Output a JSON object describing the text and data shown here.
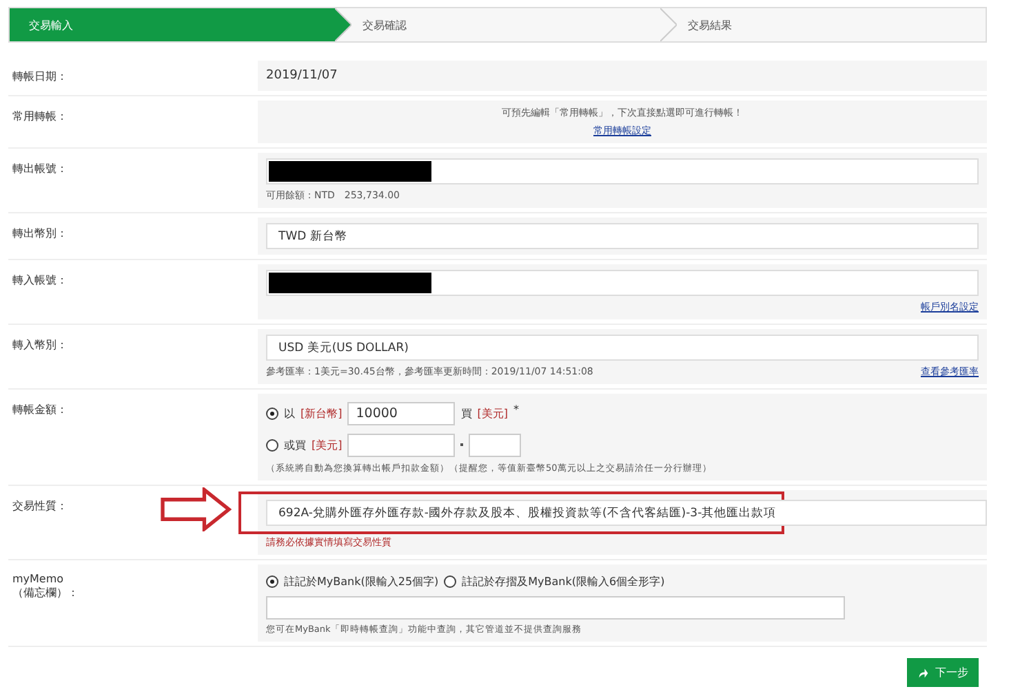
{
  "steps": [
    {
      "label": "交易輸入",
      "selected": true
    },
    {
      "label": "交易確認",
      "selected": false
    },
    {
      "label": "交易結果",
      "selected": false
    }
  ],
  "form": {
    "date": {
      "label": "轉帳日期：",
      "value": "2019/11/07"
    },
    "favorite": {
      "label": "常用轉帳：",
      "hint": "可預先編輯「常用轉帳」，下次直接點選即可進行轉帳！",
      "link": "常用轉帳設定"
    },
    "from_account": {
      "label": "轉出帳號：",
      "balance": "可用餘額：NTD　253,734.00"
    },
    "from_currency": {
      "label": "轉出幣別：",
      "value": "TWD 新台幣"
    },
    "to_account": {
      "label": "轉入帳號：",
      "link": "帳戶別名設定"
    },
    "to_currency": {
      "label": "轉入幣別：",
      "value": "USD 美元(US DOLLAR)",
      "rate": "參考匯率：1美元=30.45台幣，參考匯率更新時間：2019/11/07 14:51:08",
      "link": "查看參考匯率"
    },
    "amount": {
      "label": "轉帳金額：",
      "options": [
        {
          "selected": true,
          "prefix": "以",
          "currency": "[新台幣]",
          "value": "10000",
          "suffix": "買",
          "suffix_currency": "[美元]",
          "mark": "*"
        },
        {
          "selected": false,
          "prefix": "或買",
          "currency": "[美元]"
        }
      ],
      "note": "（系統將自動為您換算轉出帳戶扣款金額）（提醒您，等值新臺幣50萬元以上之交易請洽任一分行辦理）"
    },
    "purpose": {
      "label": "交易性質：",
      "value": "692A-兌購外匯存外匯存款-國外存款及股本、股權投資款等(不含代客結匯)-3-其他匯出款項",
      "warning": "請務必依據實情填寫交易性質"
    },
    "memo": {
      "label": "myMemo",
      "label_sub": "（備忘欄）：",
      "options": [
        {
          "selected": true,
          "label": "註記於MyBank(限輸入25個字)"
        },
        {
          "selected": false,
          "label": "註記於存摺及MyBank(限輸入6個全形字)"
        }
      ],
      "note": "您可在MyBank「即時轉帳查詢」功能中查詢，其它管道並不提供查詢服務"
    }
  },
  "next_button": "下一步"
}
